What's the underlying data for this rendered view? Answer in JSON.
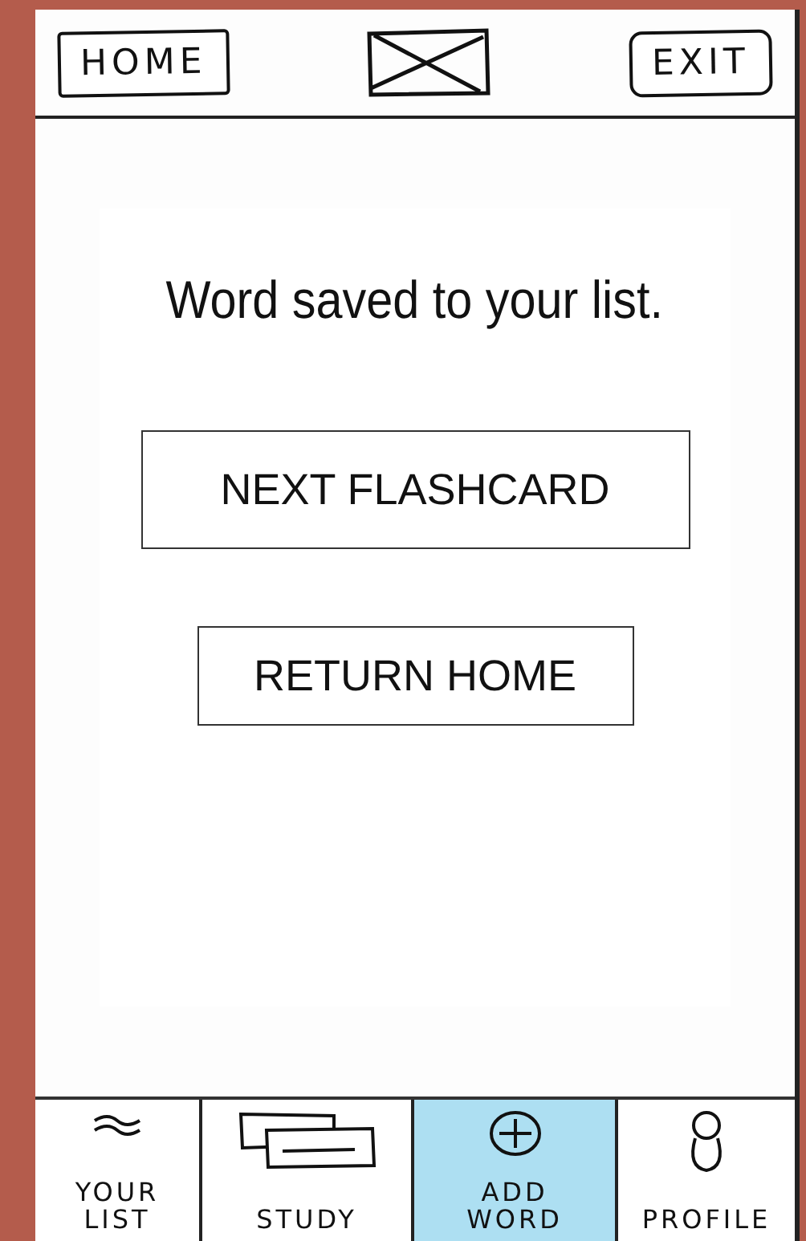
{
  "header": {
    "home": "HOME",
    "exit": "EXIT"
  },
  "message": "Word saved to your list.",
  "buttons": [
    {
      "label": "NEXT FLASHCARD",
      "kind": "wide"
    },
    {
      "label": "RETURN HOME",
      "kind": "narrow"
    }
  ],
  "tabs": [
    {
      "label": "YOUR LIST",
      "kind": "list",
      "selected": false
    },
    {
      "label": "STUDY",
      "kind": "cards",
      "selected": false
    },
    {
      "label": "ADD WORD",
      "kind": "plus",
      "selected": true
    },
    {
      "label": "PROFILE",
      "kind": "person",
      "selected": false
    }
  ]
}
